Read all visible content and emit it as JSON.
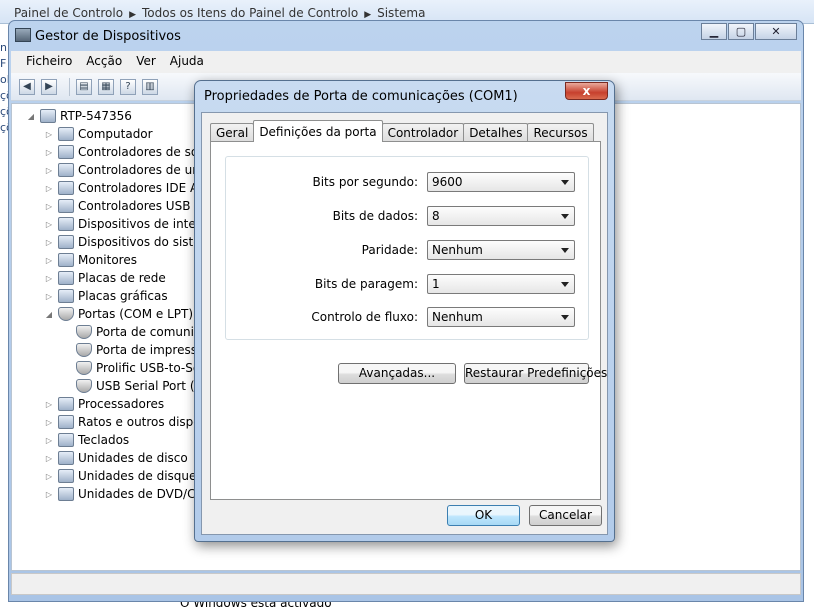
{
  "breadcrumb": [
    "Painel de Controlo",
    "Todos os Itens do Painel de Controlo",
    "Sistema"
  ],
  "left_edge_text": [
    "n F",
    "olo",
    "",
    "çõ",
    "",
    "çõ",
    "",
    "çõ"
  ],
  "os_status": "O Windows está activado",
  "main_window": {
    "title": "Gestor de Dispositivos",
    "menu": [
      "Ficheiro",
      "Acção",
      "Ver",
      "Ajuda"
    ],
    "tree": {
      "root": "RTP-547356",
      "items": [
        {
          "label": "Computador",
          "expanded": false
        },
        {
          "label": "Controladores de som",
          "expanded": false
        },
        {
          "label": "Controladores de unid",
          "expanded": false
        },
        {
          "label": "Controladores IDE AT",
          "expanded": false
        },
        {
          "label": "Controladores USB (U",
          "expanded": false
        },
        {
          "label": "Dispositivos de interfa",
          "expanded": false
        },
        {
          "label": "Dispositivos do sistem",
          "expanded": false
        },
        {
          "label": "Monitores",
          "expanded": false
        },
        {
          "label": "Placas de rede",
          "expanded": false
        },
        {
          "label": "Placas gráficas",
          "expanded": false
        },
        {
          "label": "Portas (COM e LPT)",
          "expanded": true,
          "children": [
            "Porta de comunic",
            "Porta de impresso",
            "Prolific USB-to-Se",
            "USB Serial Port (C"
          ]
        },
        {
          "label": "Processadores",
          "expanded": false
        },
        {
          "label": "Ratos e outros disposi",
          "expanded": false
        },
        {
          "label": "Teclados",
          "expanded": false
        },
        {
          "label": "Unidades de disco",
          "expanded": false
        },
        {
          "label": "Unidades de disquete",
          "expanded": false
        },
        {
          "label": "Unidades de DVD/CD-",
          "expanded": false
        }
      ]
    }
  },
  "dialog": {
    "title": "Propriedades de Porta de comunicações (COM1)",
    "close_label": "x",
    "tabs": [
      "Geral",
      "Definições da porta",
      "Controlador",
      "Detalhes",
      "Recursos"
    ],
    "active_tab": "Definições da porta",
    "fields": [
      {
        "label": "Bits por segundo:",
        "value": "9600"
      },
      {
        "label": "Bits de dados:",
        "value": "8"
      },
      {
        "label": "Paridade:",
        "value": "Nenhum"
      },
      {
        "label": "Bits de paragem:",
        "value": "1"
      },
      {
        "label": "Controlo de fluxo:",
        "value": "Nenhum"
      }
    ],
    "advanced_label": "Avançadas...",
    "restore_label": "Restaurar Predefinições",
    "ok_label": "OK",
    "cancel_label": "Cancelar"
  }
}
